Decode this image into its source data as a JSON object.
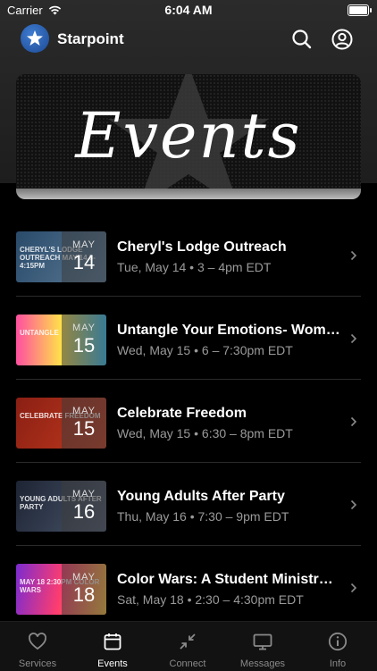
{
  "status": {
    "carrier": "Carrier",
    "time": "6:04 AM"
  },
  "header": {
    "app_name": "Starpoint",
    "search_icon": "search-icon",
    "profile_icon": "profile-icon"
  },
  "hero": {
    "title": "Events"
  },
  "events": [
    {
      "title": "Cheryl's Lodge Outreach",
      "time": "Tue, May 14 • 3 – 4pm EDT",
      "month": "MAY",
      "day": "14",
      "thumb_text": "Cheryl's Lodge Outreach May 14 3-4:15pm",
      "thumb_colors": [
        "#2a4a6a",
        "#5a7a96"
      ]
    },
    {
      "title": "Untangle Your Emotions- Wom…",
      "time": "Wed, May 15 • 6 – 7:30pm EDT",
      "month": "MAY",
      "day": "15",
      "thumb_text": "Untangle",
      "thumb_colors": [
        "#ff4fa0",
        "#36c6ff"
      ]
    },
    {
      "title": "Celebrate Freedom",
      "time": "Wed, May 15 • 6:30 – 8pm EDT",
      "month": "MAY",
      "day": "15",
      "thumb_text": "Celebrate Freedom",
      "thumb_colors": [
        "#8a1f14",
        "#c23a1d"
      ]
    },
    {
      "title": "Young Adults After Party",
      "time": "Thu, May 16 • 7:30 – 9pm EDT",
      "month": "MAY",
      "day": "16",
      "thumb_text": "Young Adults After Party",
      "thumb_colors": [
        "#1d2433",
        "#4a566c"
      ]
    },
    {
      "title": "Color Wars: A Student Ministr…",
      "time": "Sat, May 18 • 2:30 – 4:30pm EDT",
      "month": "MAY",
      "day": "18",
      "thumb_text": "May 18 2:30pm Color Wars",
      "thumb_colors": [
        "#7b2bd0",
        "#ff3d6e"
      ]
    }
  ],
  "tabs": [
    {
      "label": "Services",
      "icon": "heart-icon",
      "active": false
    },
    {
      "label": "Events",
      "icon": "calendar-icon",
      "active": true
    },
    {
      "label": "Connect",
      "icon": "connect-icon",
      "active": false
    },
    {
      "label": "Messages",
      "icon": "tv-icon",
      "active": false
    },
    {
      "label": "Info",
      "icon": "info-icon",
      "active": false
    }
  ],
  "colors": {
    "background": "#000000",
    "accent_logo": "#2a5fae",
    "secondary_text": "#9a9a9a"
  }
}
